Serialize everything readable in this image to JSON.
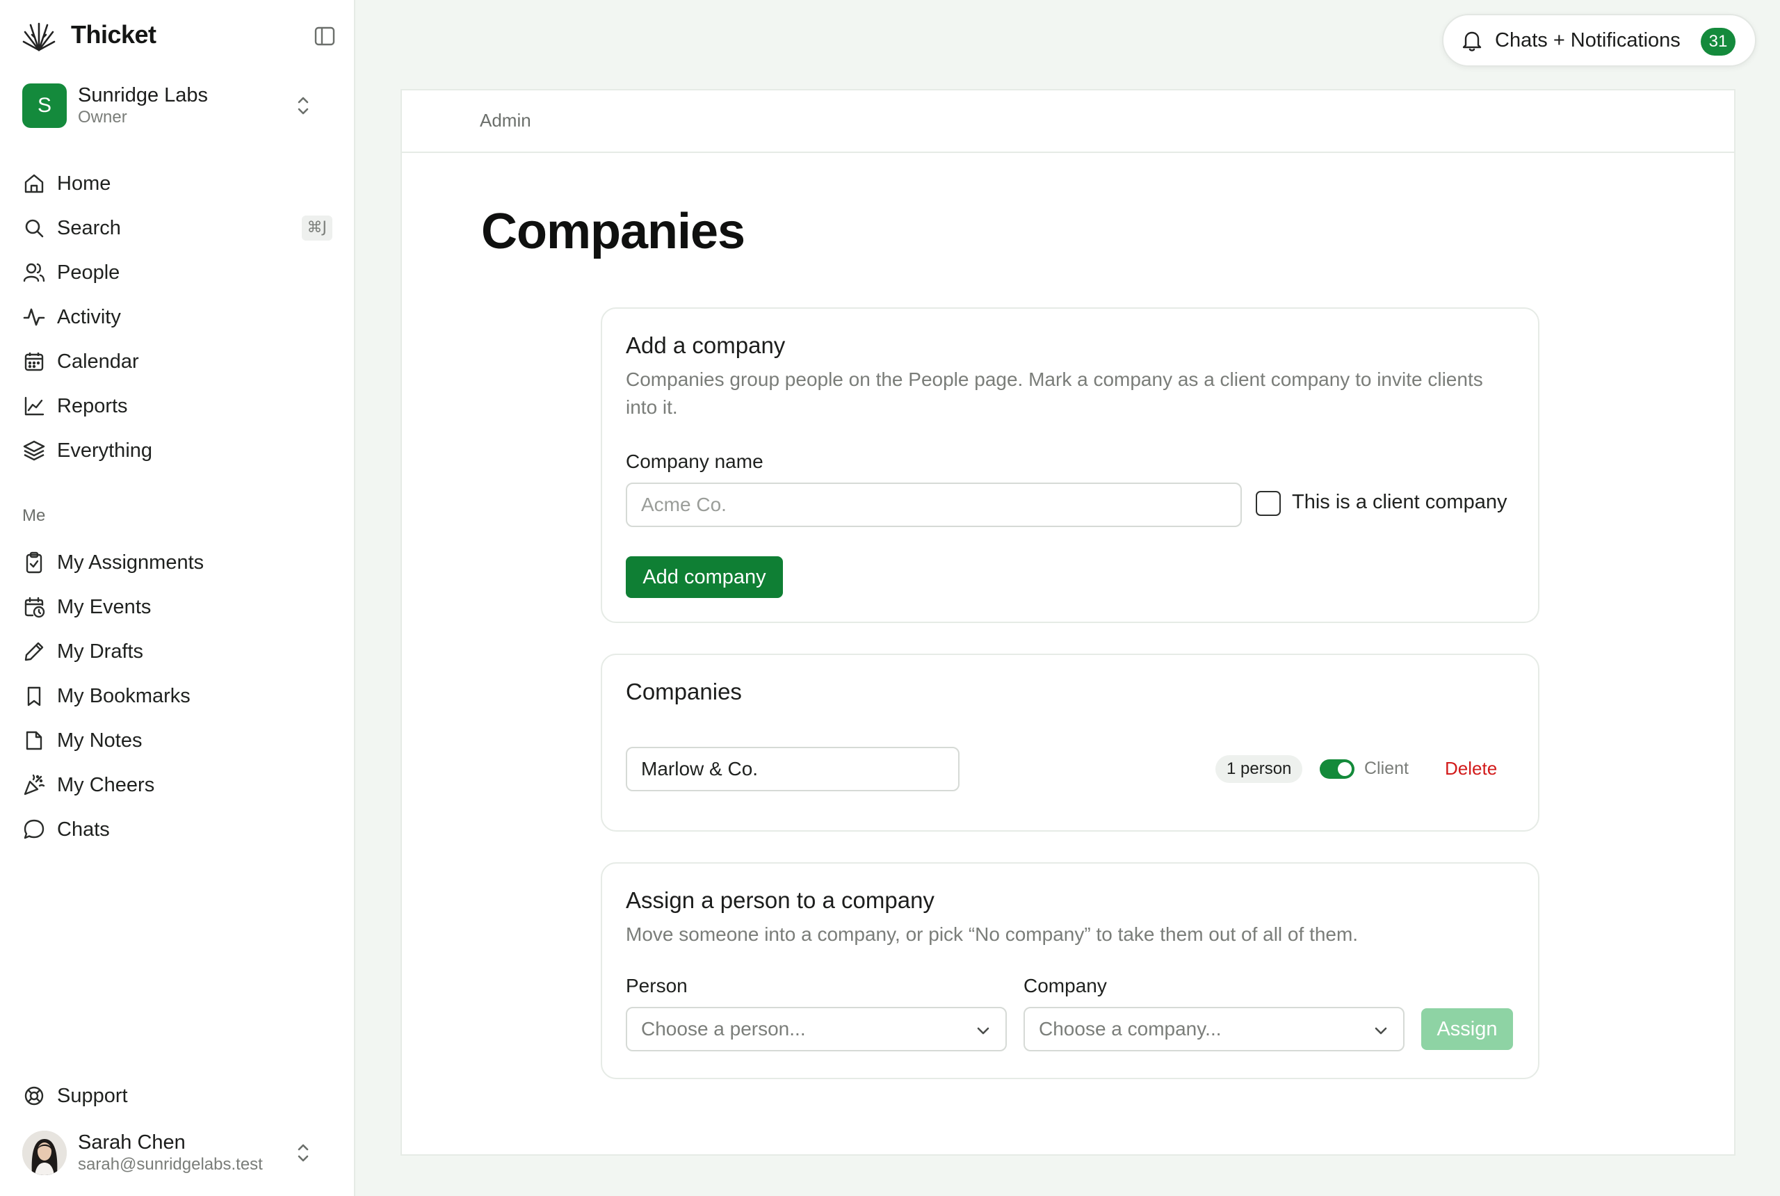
{
  "app": {
    "name": "Thicket"
  },
  "org": {
    "name": "Sunridge Labs",
    "role": "Owner",
    "initial": "S"
  },
  "nav": [
    {
      "label": "Home",
      "icon": "home-icon"
    },
    {
      "label": "Search",
      "icon": "search-icon",
      "shortcut": "⌘J"
    },
    {
      "label": "People",
      "icon": "people-icon"
    },
    {
      "label": "Activity",
      "icon": "activity-icon"
    },
    {
      "label": "Calendar",
      "icon": "calendar-icon"
    },
    {
      "label": "Reports",
      "icon": "chart-icon"
    },
    {
      "label": "Everything",
      "icon": "layers-icon"
    }
  ],
  "me_section": {
    "label": "Me"
  },
  "me_nav": [
    {
      "label": "My Assignments",
      "icon": "clipboard-icon"
    },
    {
      "label": "My Events",
      "icon": "calendar-clock-icon"
    },
    {
      "label": "My Drafts",
      "icon": "pencil-icon"
    },
    {
      "label": "My Bookmarks",
      "icon": "bookmark-icon"
    },
    {
      "label": "My Notes",
      "icon": "note-icon"
    },
    {
      "label": "My Cheers",
      "icon": "party-icon"
    },
    {
      "label": "Chats",
      "icon": "chat-icon"
    }
  ],
  "support": {
    "label": "Support"
  },
  "user": {
    "name": "Sarah Chen",
    "email": "sarah@sunridgelabs.test"
  },
  "notifications": {
    "label": "Chats + Notifications",
    "count": "31"
  },
  "breadcrumb": {
    "label": "Admin"
  },
  "page": {
    "title": "Companies"
  },
  "add_company": {
    "title": "Add a company",
    "description": "Companies group people on the People page. Mark a company as a client company to invite clients into it.",
    "name_label": "Company name",
    "name_placeholder": "Acme Co.",
    "client_checkbox_label": "This is a client company",
    "client_checked": false,
    "button_label": "Add company"
  },
  "companies": {
    "title": "Companies",
    "items": [
      {
        "name": "Marlow & Co.",
        "people": "1 person",
        "client_label": "Client",
        "client": true,
        "delete_label": "Delete"
      }
    ]
  },
  "assign": {
    "title": "Assign a person to a company",
    "description": "Move someone into a company, or pick “No company” to take them out of all of them.",
    "person_label": "Person",
    "person_placeholder": "Choose a person...",
    "company_label": "Company",
    "company_placeholder": "Choose a company...",
    "button_label": "Assign",
    "button_enabled": false
  },
  "colors": {
    "accent": "#148a3c",
    "danger": "#d21b1b",
    "background": "#f2f6f2"
  }
}
